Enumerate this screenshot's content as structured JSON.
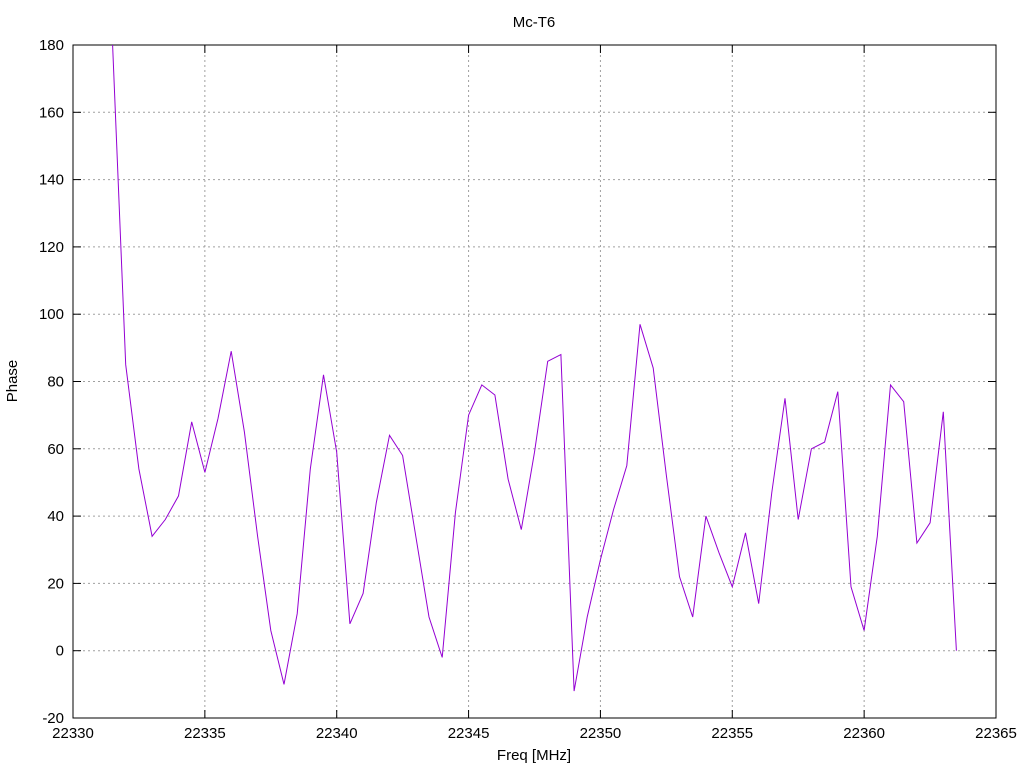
{
  "chart_data": {
    "type": "line",
    "title": "Mc-T6",
    "xlabel": "Freq [MHz]",
    "ylabel": "Phase",
    "xlim": [
      22330,
      22365
    ],
    "ylim": [
      -20,
      180
    ],
    "xticks": [
      22330,
      22335,
      22340,
      22345,
      22350,
      22355,
      22360,
      22365
    ],
    "yticks": [
      -20,
      0,
      20,
      40,
      60,
      80,
      100,
      120,
      140,
      160,
      180
    ],
    "grid": true,
    "line_color": "#9400d3",
    "series": [
      {
        "x": [
          22331.5,
          22332.0,
          22332.5,
          22333.0,
          22333.5,
          22334.0,
          22334.5,
          22335.0,
          22335.5,
          22336.0,
          22336.5,
          22337.0,
          22337.5,
          22338.0,
          22338.5,
          22339.0,
          22339.5,
          22340.0,
          22340.5,
          22341.0,
          22341.5,
          22342.0,
          22342.5,
          22343.0,
          22343.5,
          22344.0,
          22344.5,
          22345.0,
          22345.5,
          22346.0,
          22346.5,
          22347.0,
          22347.5,
          22348.0,
          22348.5,
          22349.0,
          22349.5,
          22350.0,
          22350.5,
          22351.0,
          22351.5,
          22352.0,
          22352.5,
          22353.0,
          22353.5,
          22354.0,
          22354.5,
          22355.0,
          22355.5,
          22356.0,
          22356.5,
          22357.0,
          22357.5,
          22358.0,
          22358.5,
          22359.0,
          22359.5,
          22360.0,
          22360.5,
          22361.0,
          22361.5,
          22362.0,
          22362.5,
          22363.0,
          22363.5
        ],
        "values": [
          180,
          85,
          54,
          34,
          39,
          46,
          68,
          53,
          69,
          89,
          65,
          34,
          6,
          -10,
          11,
          54,
          82,
          59,
          8,
          17,
          44,
          64,
          58,
          34,
          10,
          -2,
          41,
          70,
          79,
          76,
          51,
          36,
          59,
          86,
          88,
          -12,
          10,
          27,
          42,
          55,
          97,
          84,
          52,
          22,
          10,
          40,
          29,
          19,
          35,
          14,
          47,
          75,
          39,
          60,
          62,
          77,
          19,
          6,
          34,
          79,
          74,
          32,
          38,
          71,
          0
        ]
      }
    ]
  }
}
